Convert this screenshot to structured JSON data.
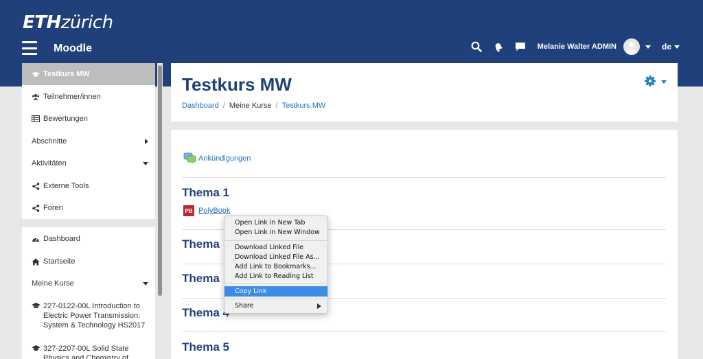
{
  "header": {
    "logo_eth": "ETH",
    "logo_zurich": "zürich",
    "brand": "Moodle",
    "user_name": "Melanie Walter ADMIN",
    "language": "de"
  },
  "sidebar": {
    "block1": [
      {
        "label": "Testkurs MW",
        "icon": "graduation-cap-icon"
      },
      {
        "label": "Teilnehmer/innen",
        "icon": "users-icon"
      },
      {
        "label": "Bewertungen",
        "icon": "table-icon"
      },
      {
        "label": "Abschnitte"
      },
      {
        "label": "Aktivitäten"
      },
      {
        "label": "Externe Tools",
        "icon": "share-icon"
      },
      {
        "label": "Foren",
        "icon": "share-icon"
      }
    ],
    "block2": [
      {
        "label": "Dashboard",
        "icon": "dashboard-icon"
      },
      {
        "label": "Startseite",
        "icon": "home-icon"
      },
      {
        "label": "Meine Kurse"
      }
    ],
    "courses": [
      "227-0122-00L Introduction to Electric Power Transmission: System & Technology HS2017",
      "327-2207-00L Solid State Physics and Chemistry of"
    ]
  },
  "page": {
    "title": "Testkurs MW",
    "breadcrumb": [
      "Dashboard",
      "/",
      "Meine Kurse",
      "/",
      "Testkurs MW"
    ]
  },
  "content": {
    "announcements": "Ankündigungen",
    "sections": [
      "Thema 1",
      "Thema 2",
      "Thema 3",
      "Thema 4",
      "Thema 5"
    ],
    "section_labels_visible": [
      "Thema 1",
      "Thema",
      "Thema",
      "Thema 4",
      "Thema 5"
    ],
    "polybook_badge": "PB",
    "polybook_link": "PolyBook"
  },
  "context_menu": {
    "items": [
      "Open Link in New Tab",
      "Open Link in New Window",
      "Download Linked File",
      "Download Linked File As...",
      "Add Link to Bookmarks...",
      "Add Link to Reading List",
      "Copy Link",
      "Share"
    ],
    "highlighted": "Copy Link"
  },
  "colors": {
    "header_bg": "#1f407a",
    "link": "#1f6fb5",
    "title": "#1f407a",
    "menu_highlight": "#3c8ce7"
  }
}
